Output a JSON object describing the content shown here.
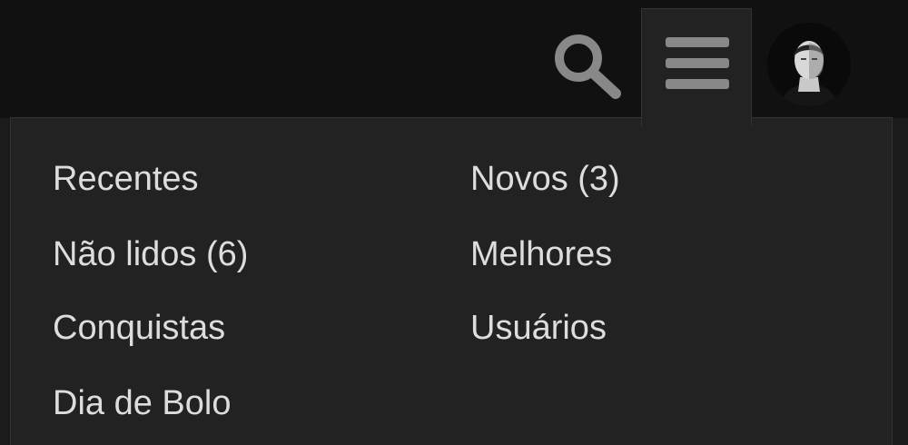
{
  "header": {
    "icons": {
      "search": "search-icon",
      "menu": "hamburger-menu-icon",
      "avatar": "user-avatar"
    },
    "colors": {
      "header_bg": "#111111",
      "panel_bg": "#222222",
      "icon": "#888888",
      "text": "#dddddd"
    }
  },
  "menu": {
    "left": [
      {
        "label": "Recentes"
      },
      {
        "label": "Não lidos (6)"
      },
      {
        "label": "Conquistas"
      },
      {
        "label": "Dia de Bolo"
      }
    ],
    "right": [
      {
        "label": "Novos (3)"
      },
      {
        "label": "Melhores"
      },
      {
        "label": "Usuários"
      }
    ]
  }
}
